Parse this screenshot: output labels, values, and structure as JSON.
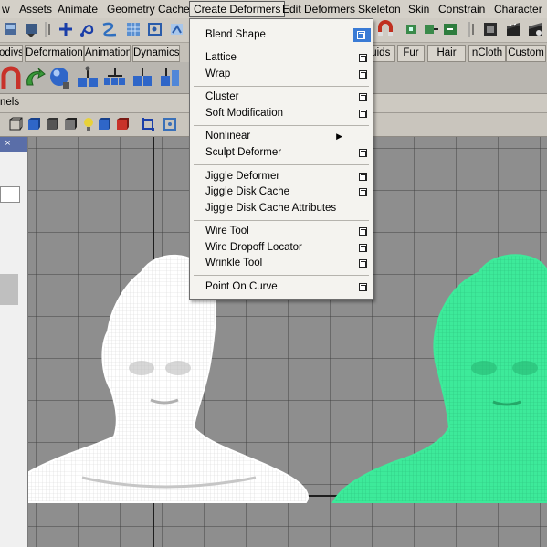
{
  "menubar": {
    "items": [
      "w",
      "Assets",
      "Animate",
      "Geometry Cache",
      "Create Deformers",
      "Edit Deformers",
      "Skeleton",
      "Skin",
      "Constrain",
      "Character"
    ]
  },
  "shelf_tabs": [
    "odivs",
    "Deformation",
    "Animation",
    "Dynamics",
    "luids",
    "Fur",
    "Hair",
    "nCloth",
    "Custom"
  ],
  "panels_label": "nels",
  "create_deformers_menu": {
    "blend_shape": "Blend Shape",
    "lattice": "Lattice",
    "wrap": "Wrap",
    "cluster": "Cluster",
    "soft_modification": "Soft Modification",
    "nonlinear": "Nonlinear",
    "sculpt_deformer": "Sculpt Deformer",
    "jiggle_deformer": "Jiggle Deformer",
    "jiggle_disk_cache": "Jiggle Disk Cache",
    "jiggle_disk_cache_attributes": "Jiggle Disk Cache Attributes",
    "wire_tool": "Wire Tool",
    "wire_dropoff_locator": "Wire Dropoff Locator",
    "wrinkle_tool": "Wrinkle Tool",
    "point_on_curve": "Point On Curve"
  },
  "side_panel": {
    "close_glyph": "×"
  },
  "colors": {
    "menu_highlight": "#3a7bd5",
    "viewport_background": "#8e8e8e",
    "wireframe_white": "#ffffff",
    "wireframe_green": "#3dea9a"
  }
}
